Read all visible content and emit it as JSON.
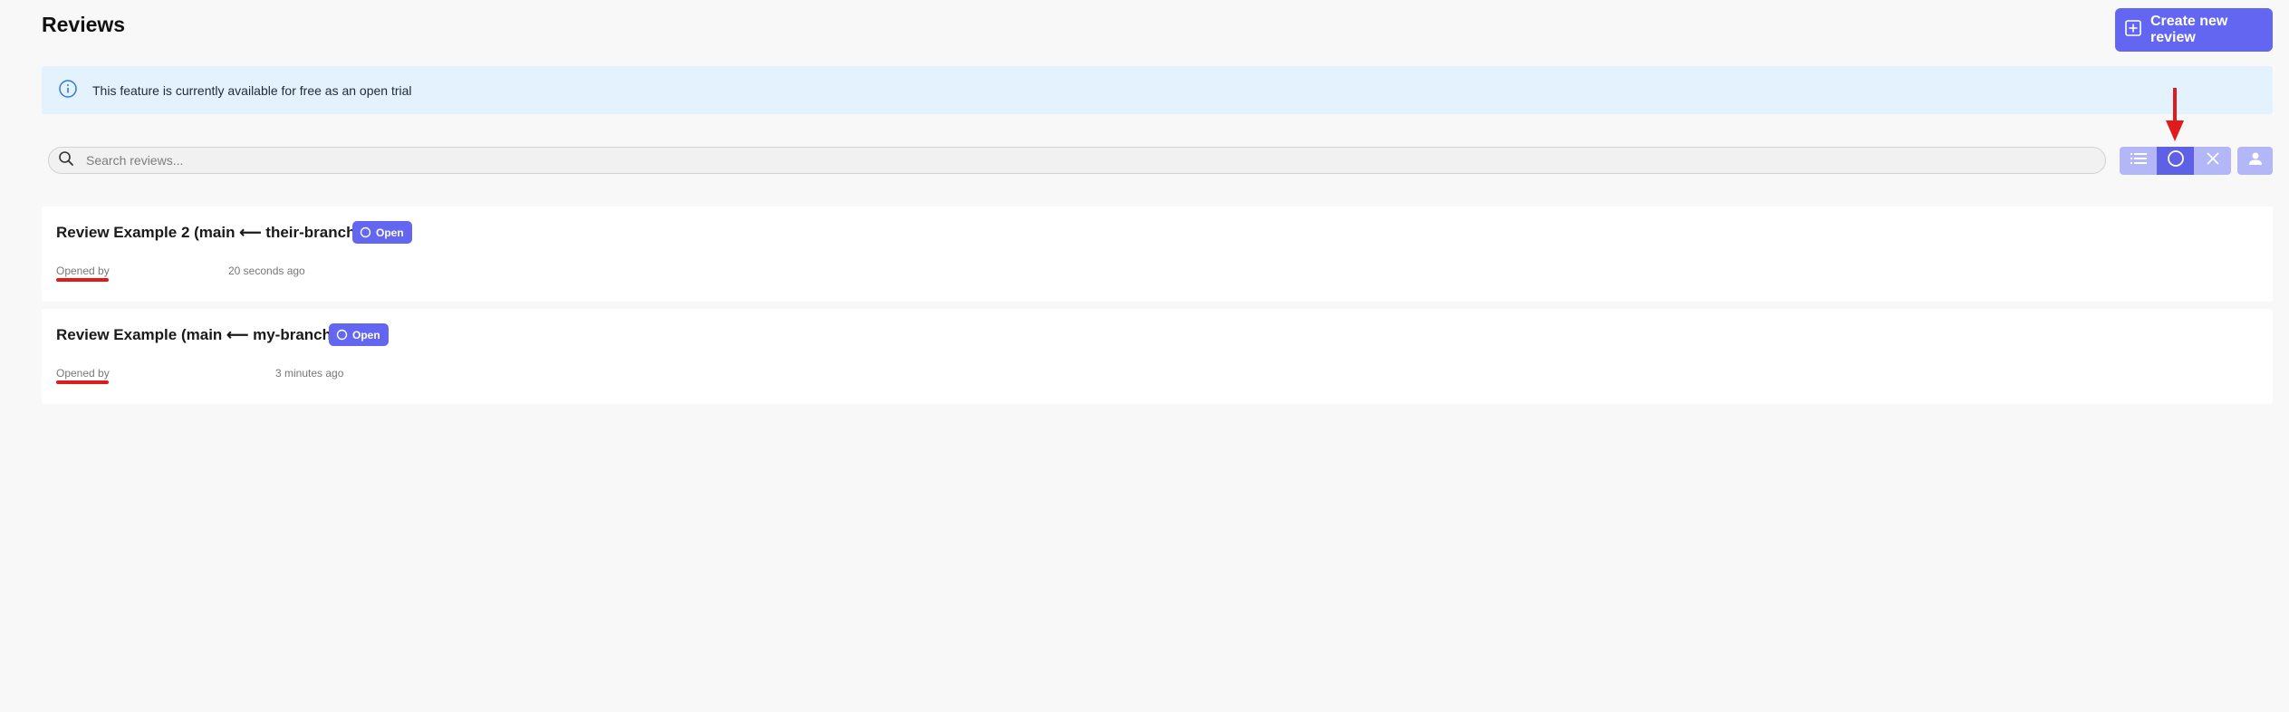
{
  "header": {
    "title": "Reviews",
    "create_button_label": "Create new review",
    "create_button_icon": "plus-square-icon"
  },
  "banner": {
    "icon": "info-icon",
    "text": "This feature is currently available for free as an open trial"
  },
  "search": {
    "placeholder": "Search reviews...",
    "value": "",
    "icon": "search-icon"
  },
  "filters": {
    "buttons": [
      {
        "icon": "list-icon",
        "active": false
      },
      {
        "icon": "circle-icon",
        "active": true
      },
      {
        "icon": "close-icon",
        "active": false
      }
    ],
    "user_filter_icon": "user-icon"
  },
  "reviews": [
    {
      "title": "Review Example 2 (main ⟵ their-branch)",
      "status": "Open",
      "opened_by_label": "Opened by",
      "time": "20 seconds ago"
    },
    {
      "title": "Review Example (main ⟵ my-branch)",
      "status": "Open",
      "opened_by_label": "Opened by",
      "time": "3 minutes ago"
    }
  ],
  "colors": {
    "accent": "#6366f1",
    "accent_light": "#b4b7f7",
    "banner_bg": "#e3f2fc",
    "annotation_red": "#e01b1b",
    "page_bg": "#f8f8f8"
  }
}
